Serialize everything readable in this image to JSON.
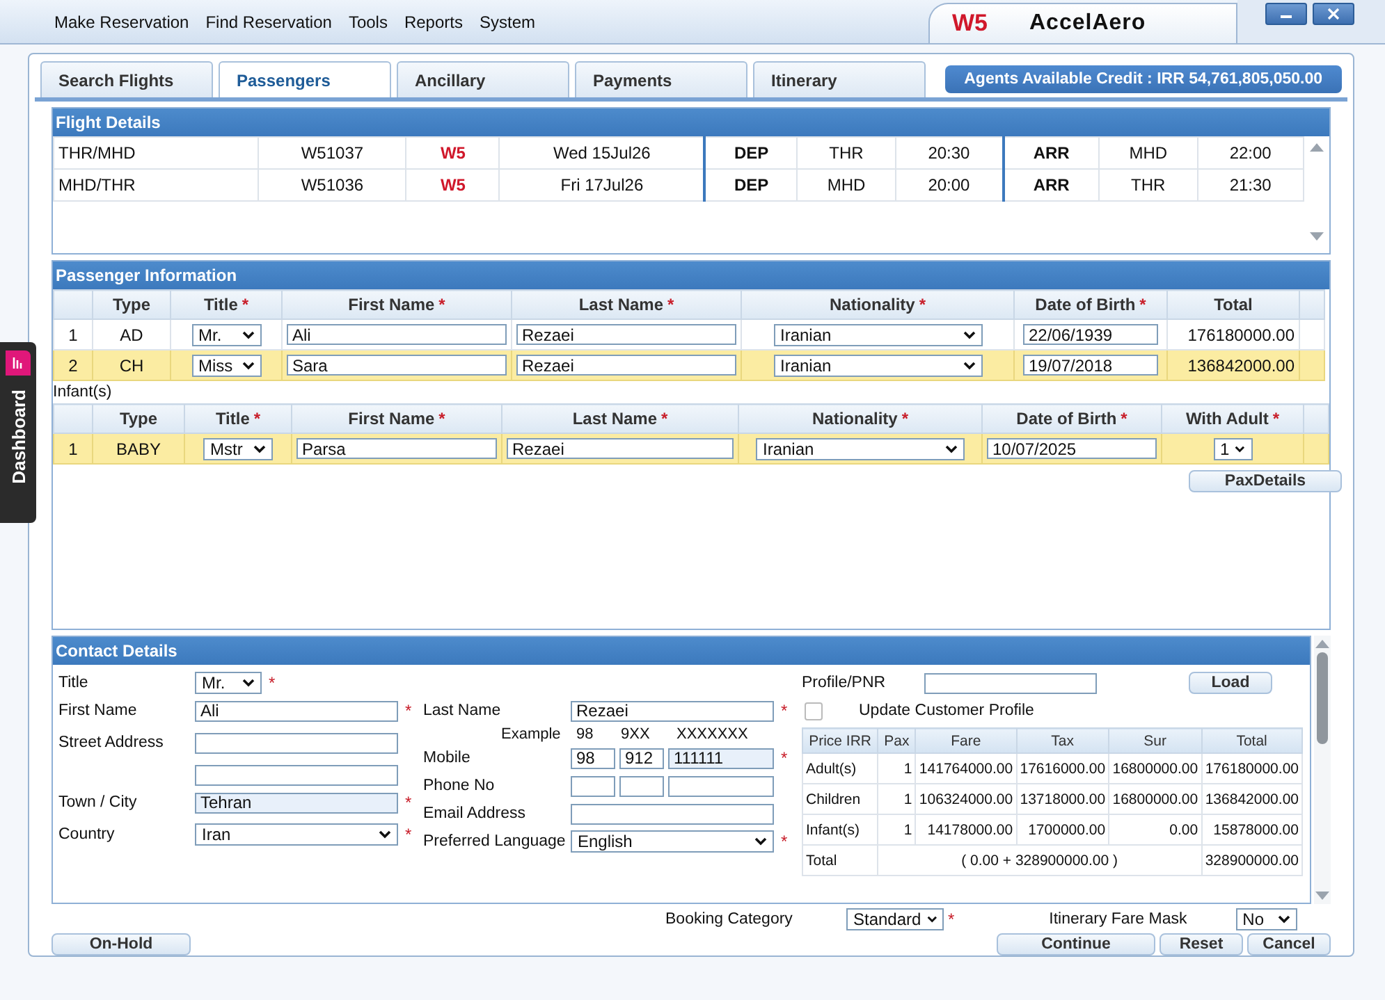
{
  "menu": [
    "Make Reservation",
    "Find Reservation",
    "Tools",
    "Reports",
    "System"
  ],
  "brand": {
    "code": "W5",
    "name": "AccelAero"
  },
  "side_tab": "Dashboard",
  "required_mark": "*",
  "tabs": [
    {
      "label": "Search Flights",
      "selected": false
    },
    {
      "label": "Passengers",
      "selected": true
    },
    {
      "label": "Ancillary",
      "selected": false
    },
    {
      "label": "Payments",
      "selected": false
    },
    {
      "label": "Itinerary",
      "selected": false
    }
  ],
  "credit": "Agents Available Credit : IRR 54,761,805,050.00",
  "flight_details": {
    "title": "Flight Details",
    "rows": [
      {
        "segment": "THR/MHD",
        "flight": "W51037",
        "carrier": "W5",
        "date": "Wed 15Jul26",
        "dep_label": "DEP",
        "dep_airport": "THR",
        "dep_time": "20:30",
        "arr_label": "ARR",
        "arr_airport": "MHD",
        "arr_time": "22:00"
      },
      {
        "segment": "MHD/THR",
        "flight": "W51036",
        "carrier": "W5",
        "date": "Fri 17Jul26",
        "dep_label": "DEP",
        "dep_airport": "MHD",
        "dep_time": "20:00",
        "arr_label": "ARR",
        "arr_airport": "THR",
        "arr_time": "21:30"
      }
    ]
  },
  "passengers": {
    "title": "Passenger Information",
    "columns": [
      {
        "label": "Type",
        "required": false
      },
      {
        "label": "Title",
        "required": true
      },
      {
        "label": "First Name",
        "required": true
      },
      {
        "label": "Last Name",
        "required": true
      },
      {
        "label": "Nationality",
        "required": true
      },
      {
        "label": "Date of Birth",
        "required": true
      },
      {
        "label": "Total",
        "required": false
      }
    ],
    "rows": [
      {
        "no": "1",
        "type": "AD",
        "title": "Mr.",
        "first_name": "Ali",
        "last_name": "Rezaei",
        "nationality": "Iranian",
        "dob": "22/06/1939",
        "total": "176180000.00",
        "selected": false
      },
      {
        "no": "2",
        "type": "CH",
        "title": "Miss",
        "first_name": "Sara",
        "last_name": "Rezaei",
        "nationality": "Iranian",
        "dob": "19/07/2018",
        "total": "136842000.00",
        "selected": true
      }
    ]
  },
  "infants": {
    "label": "Infant(s)",
    "columns": [
      {
        "label": "Type",
        "required": false
      },
      {
        "label": "Title",
        "required": true
      },
      {
        "label": "First Name",
        "required": true
      },
      {
        "label": "Last Name",
        "required": true
      },
      {
        "label": "Nationality",
        "required": true
      },
      {
        "label": "Date of Birth",
        "required": true
      },
      {
        "label": "With Adult",
        "required": true
      }
    ],
    "rows": [
      {
        "no": "1",
        "type": "BABY",
        "title": "Mstr",
        "first_name": "Parsa",
        "last_name": "Rezaei",
        "nationality": "Iranian",
        "dob": "10/07/2025",
        "with_adult": "1",
        "selected": true
      }
    ]
  },
  "pax_details_button": "PaxDetails",
  "contact": {
    "title": "Contact Details",
    "title_label": "Title",
    "title_value": "Mr.",
    "first_name_label": "First Name",
    "first_name": "Ali",
    "street_label": "Street Address",
    "town_label": "Town / City",
    "town": "Tehran",
    "country_label": "Country",
    "country": "Iran",
    "last_name_label": "Last Name",
    "last_name": "Rezaei",
    "example_label": "Example",
    "example_parts": [
      "98",
      "9XX",
      "XXXXXXX"
    ],
    "mobile_label": "Mobile",
    "mobile_parts": [
      "98",
      "912",
      "111111"
    ],
    "phone_label": "Phone No",
    "email_label": "Email Address",
    "language_label": "Preferred Language",
    "language": "English",
    "profile_label": "Profile/PNR",
    "load_button": "Load",
    "update_profile": {
      "label": "Update Customer Profile",
      "checked": false
    }
  },
  "price_table": {
    "columns": [
      "Price  IRR",
      "Pax",
      "Fare",
      "Tax",
      "Sur",
      "Total"
    ],
    "rows": [
      [
        "Adult(s)",
        "1",
        "141764000.00",
        "17616000.00",
        "16800000.00",
        "176180000.00"
      ],
      [
        "Children",
        "1",
        "106324000.00",
        "13718000.00",
        "16800000.00",
        "136842000.00"
      ],
      [
        "Infant(s)",
        "1",
        "14178000.00",
        "1700000.00",
        "0.00",
        "15878000.00"
      ]
    ],
    "total": {
      "label": "Total",
      "sum": "( 0.00  +  328900000.00 )",
      "value": "328900000.00"
    }
  },
  "booking_category": {
    "label": "Booking Category",
    "value": "Standard"
  },
  "fare_mask": {
    "label": "Itinerary Fare Mask",
    "value": "No"
  },
  "buttons": {
    "on_hold": "On-Hold",
    "continue": "Continue",
    "reset": "Reset",
    "cancel": "Cancel"
  }
}
